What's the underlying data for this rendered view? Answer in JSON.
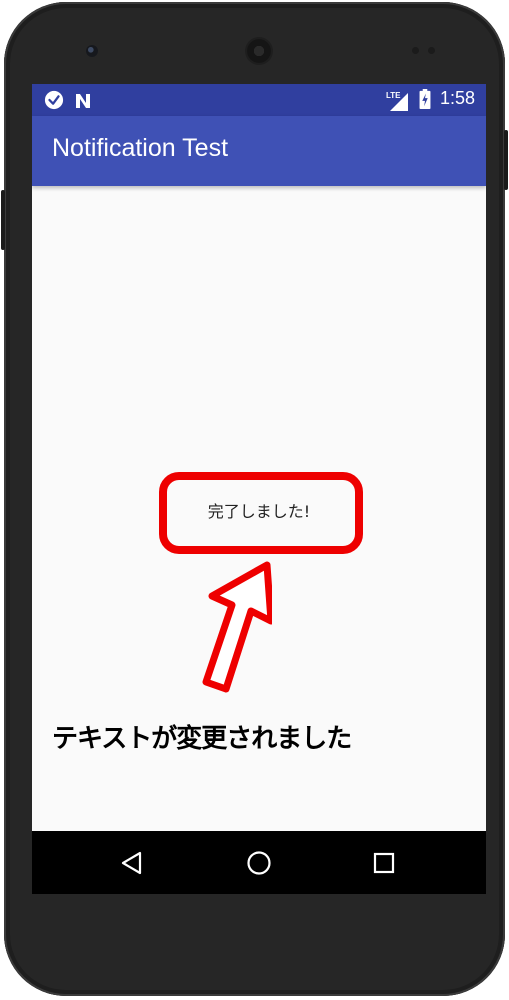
{
  "status_bar": {
    "time": "1:58",
    "network_label": "LTE",
    "icons": [
      "clock-notification-icon",
      "n-notification-icon",
      "signal-icon",
      "battery-charging-icon"
    ]
  },
  "app_bar": {
    "title": "Notification Test"
  },
  "main": {
    "message_text": "完了しました!"
  },
  "annotation": {
    "caption": "テキストが変更されました",
    "highlight_color": "#ee0000"
  },
  "nav_bar": {
    "icons": [
      "back-icon",
      "home-icon",
      "recents-icon"
    ]
  },
  "colors": {
    "status_bar": "#303f9f",
    "app_bar": "#3f51b5",
    "background": "#fafafa",
    "nav_bar": "#000000"
  }
}
